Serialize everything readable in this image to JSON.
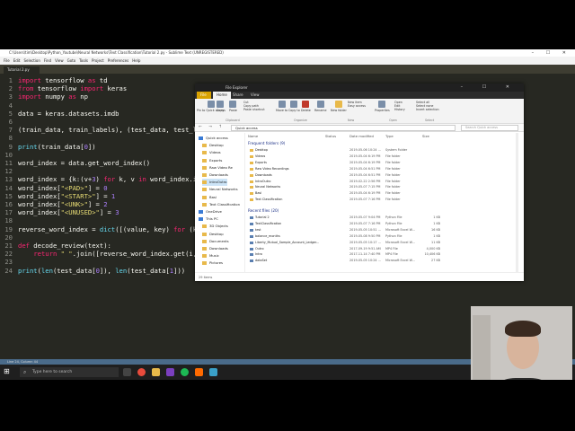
{
  "sublime": {
    "title": "C:\\Users\\tim\\Desktop\\Python_Youtube\\Neural Networks\\Text Classification\\Tutorial 2.py - Sublime Text (UNREGISTERED)",
    "menu": [
      "File",
      "Edit",
      "Selection",
      "Find",
      "View",
      "Goto",
      "Tools",
      "Project",
      "Preferences",
      "Help"
    ],
    "tab": "Tutorial 2.py",
    "status": "Line 24, Column 44",
    "lines": [
      {
        "n": "1",
        "text": "import tensorflow as td"
      },
      {
        "n": "2",
        "text": "from tensorflow import keras"
      },
      {
        "n": "3",
        "text": "import numpy as np"
      },
      {
        "n": "4",
        "text": ""
      },
      {
        "n": "5",
        "text": "data = keras.datasets.imdb"
      },
      {
        "n": "6",
        "text": ""
      },
      {
        "n": "7",
        "text": "(train_data, train_labels), (test_data, test_la"
      },
      {
        "n": "8",
        "text": ""
      },
      {
        "n": "9",
        "text": "print(train_data[0])"
      },
      {
        "n": "10",
        "text": ""
      },
      {
        "n": "11",
        "text": "word_index = data.get_word_index()"
      },
      {
        "n": "12",
        "text": ""
      },
      {
        "n": "13",
        "text": "word_index = {k:(v+3) for k, v in word_index.it"
      },
      {
        "n": "14",
        "text": "word_index[\"<PAD>\"] = 0"
      },
      {
        "n": "15",
        "text": "word_index[\"<START>\"] = 1"
      },
      {
        "n": "16",
        "text": "word_index[\"<UNK>\"] = 2"
      },
      {
        "n": "17",
        "text": "word_index[\"<UNUSED>\"] = 3"
      },
      {
        "n": "18",
        "text": ""
      },
      {
        "n": "19",
        "text": "reverse_word_index = dict([(value, key) for (ke"
      },
      {
        "n": "20",
        "text": ""
      },
      {
        "n": "21",
        "text": "def decode_review(text):"
      },
      {
        "n": "22",
        "text": "    return \" \".join([reverse_word_index.get(i,"
      },
      {
        "n": "23",
        "text": ""
      },
      {
        "n": "24",
        "text": "print(len(test_data[0]), len(test_data[1]))"
      }
    ]
  },
  "taskbar": {
    "search_placeholder": "Type here to search"
  },
  "explorer": {
    "title": "File Explorer",
    "tabs": {
      "file": "File",
      "home": "Home",
      "share": "Share",
      "view": "View"
    },
    "ribbon": {
      "pin": "Pin to Quick access",
      "copy": "Copy",
      "paste": "Paste",
      "cut": "Cut",
      "copy_path": "Copy path",
      "paste_shortcut": "Paste shortcut",
      "move_to": "Move to",
      "copy_to": "Copy to",
      "delete": "Delete",
      "rename": "Rename",
      "new_folder": "New folder",
      "new_item": "New item",
      "easy_access": "Easy access",
      "properties": "Properties",
      "open": "Open",
      "edit": "Edit",
      "history": "History",
      "select_all": "Select all",
      "select_none": "Select none",
      "invert_selection": "Invert selection",
      "sec_clipboard": "Clipboard",
      "sec_organize": "Organize",
      "sec_new": "New",
      "sec_open": "Open",
      "sec_select": "Select"
    },
    "address": "Quick access",
    "search_placeholder": "Search Quick access",
    "nav": [
      {
        "label": "Quick access",
        "kind": "star"
      },
      {
        "label": "Desktop",
        "kind": "folder"
      },
      {
        "label": "Videos",
        "kind": "folder"
      },
      {
        "label": "Exports",
        "kind": "folder"
      },
      {
        "label": "Raw Video Re",
        "kind": "folder"
      },
      {
        "label": "Downloads",
        "kind": "folder"
      },
      {
        "label": "IntroOutro",
        "kind": "folder"
      },
      {
        "label": "Neural Networks",
        "kind": "folder"
      },
      {
        "label": "Basl",
        "kind": "folder"
      },
      {
        "label": "Text Classification",
        "kind": "folder"
      },
      {
        "label": "OneDrive",
        "kind": "cloud"
      },
      {
        "label": "This PC",
        "kind": "pc"
      },
      {
        "label": "3D Objects",
        "kind": "folder"
      },
      {
        "label": "Desktop",
        "kind": "folder"
      },
      {
        "label": "Documents",
        "kind": "folder"
      },
      {
        "label": "Downloads",
        "kind": "folder"
      },
      {
        "label": "Music",
        "kind": "folder"
      },
      {
        "label": "Pictures",
        "kind": "folder"
      }
    ],
    "columns": {
      "name": "Name",
      "status": "Status",
      "date": "Date modified",
      "type": "Type",
      "size": "Size"
    },
    "group_frequent": "Frequent folders (9)",
    "frequent": [
      {
        "name": "Desktop",
        "date": "2019-05-06 10:24 ...",
        "type": "System Folder"
      },
      {
        "name": "Videos",
        "date": "2019-05-04 6:19 PM",
        "type": "File folder"
      },
      {
        "name": "Exports",
        "date": "2019-05-04 6:19 PM",
        "type": "File folder"
      },
      {
        "name": "Raw Video Recordings",
        "date": "2019-05-04 6:51 PM",
        "type": "File folder"
      },
      {
        "name": "Downloads",
        "date": "2019-05-04 6:51 PM",
        "type": "File folder"
      },
      {
        "name": "IntroOutro",
        "date": "2019-02-22 2:56 PM",
        "type": "File folder"
      },
      {
        "name": "Neural Networks",
        "date": "2019-05-07 7:15 PM",
        "type": "File folder"
      },
      {
        "name": "Basl",
        "date": "2019-05-04 6:19 PM",
        "type": "File folder"
      },
      {
        "name": "Text Classification",
        "date": "2019-05-07 7:16 PM",
        "type": "File folder"
      }
    ],
    "group_recent": "Recent files (20)",
    "recent": [
      {
        "name": "Tutorial 2",
        "date": "2019-05-07 9:04 PM",
        "type": "Python File",
        "size": "1 KB"
      },
      {
        "name": "TextClassification",
        "date": "2019-05-07 7:16 PM",
        "type": "Python File",
        "size": "1 KB"
      },
      {
        "name": "test",
        "date": "2019-05-05 10:51 ...",
        "type": "Microsoft Excel W...",
        "size": "16 KB"
      },
      {
        "name": "balance_months",
        "date": "2019-05-08 9:50 PM",
        "type": "Python File",
        "size": "1 KB"
      },
      {
        "name": "Liberty_Mutual_Sample_Account_Ledger...",
        "date": "2019-05-05 10:17 ...",
        "type": "Microsoft Excel W...",
        "size": "11 KB"
      },
      {
        "name": "Outro",
        "date": "2017-09-19 9:51 AM",
        "type": "MP4 File",
        "size": "4,000 KB"
      },
      {
        "name": "Intro",
        "date": "2017-11-14 7:40 PM",
        "type": "MP4 File",
        "size": "10,406 KB"
      },
      {
        "name": "dataSet",
        "date": "2019-05-05 10:24 ...",
        "type": "Microsoft Excel W...",
        "size": "27 KB"
      }
    ],
    "status": "29 items"
  },
  "colors": {
    "editor_bg": "#272822",
    "keyword": "#f92672",
    "string": "#e6db74",
    "number": "#ae81ff",
    "file_tab": "#d9a200"
  }
}
